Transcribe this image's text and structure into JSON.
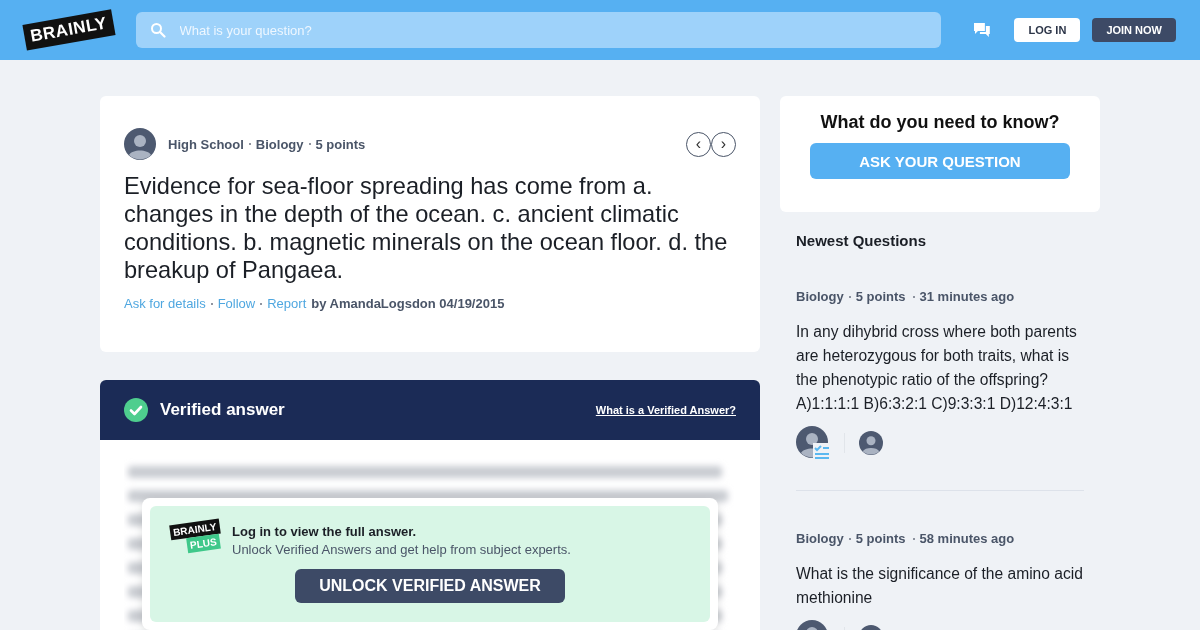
{
  "header": {
    "logo": "BRAINLY",
    "search": {
      "placeholder": "What is your question?"
    },
    "login": "LOG IN",
    "join": "JOIN NOW"
  },
  "question": {
    "meta": [
      "High School",
      "Biology",
      "5 points"
    ],
    "text": "Evidence for sea-floor spreading has come from a. changes in the depth of the ocean. c. ancient climatic conditions. b. magnetic minerals on the ocean floor. d. the breakup of Pangaea.",
    "prev": "‹",
    "next": "›",
    "links": [
      "Ask for details",
      "Follow",
      "Report"
    ],
    "byline": "by AmandaLogsdon 04/19/2015"
  },
  "answer": {
    "title": "Verified answer",
    "help_link": "What is a Verified Answer?",
    "promo": {
      "logo_top": "BRAINLY",
      "logo_bottom": "PLUS",
      "title": "Log in to view the full answer.",
      "subtitle": "Unlock Verified Answers and get help from subject experts.",
      "button": "UNLOCK VERIFIED ANSWER"
    }
  },
  "ask_card": {
    "title": "What do you need to know?",
    "button": "ASK YOUR QUESTION"
  },
  "newest": {
    "title": "Newest Questions",
    "items": [
      {
        "subject": "Biology",
        "points": "5 points",
        "time": "31 minutes ago",
        "text": "In any dihybrid cross where both parents are heterozygous for both traits, what is the phenotypic ratio of the offspring? A)1:1:1:1 B)6:3:2:1 C)9:3:3:1 D)12:4:3:1",
        "answered": true
      },
      {
        "subject": "Biology",
        "points": "5 points",
        "time": "58 minutes ago",
        "text": "What is the significance of the amino acid methionine"
      }
    ]
  }
}
